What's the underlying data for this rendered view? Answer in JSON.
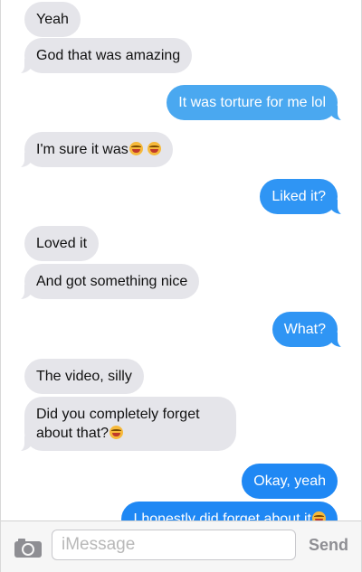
{
  "messages": [
    {
      "dir": "in",
      "text": "Yeah"
    },
    {
      "dir": "in",
      "text": "God that was amazing"
    },
    {
      "dir": "out",
      "text": "It was torture for me lol"
    },
    {
      "dir": "in",
      "text": "I'm sure it was",
      "emoji": "laughing-emoji x2"
    },
    {
      "dir": "out",
      "text": "Liked it?"
    },
    {
      "dir": "in",
      "text": "Loved it"
    },
    {
      "dir": "in",
      "text": "And got something nice"
    },
    {
      "dir": "out",
      "text": "What?"
    },
    {
      "dir": "in",
      "text": "The video, silly"
    },
    {
      "dir": "in",
      "text_line1": "Did you completely forget",
      "text_line2": "about that?",
      "emoji": "laughing-emoji"
    },
    {
      "dir": "out",
      "text": "Okay, yeah"
    },
    {
      "dir": "out",
      "text": "I honestly did forget about it",
      "emoji": "smiling-emoji"
    }
  ],
  "composer": {
    "placeholder": "iMessage",
    "send_label": "Send",
    "camera_icon": "camera-icon"
  },
  "colors": {
    "incoming_bubble": "#e5e5ea",
    "outgoing_bubble": "#2f95f4",
    "send_disabled": "#8e8e93"
  }
}
